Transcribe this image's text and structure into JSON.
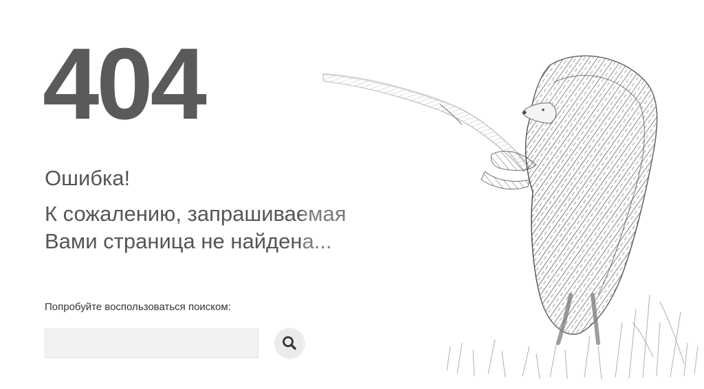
{
  "error": {
    "code": "404",
    "title": "Ошибка!",
    "message_line1": "К сожалению, запрашиваемая",
    "message_line2": "Вами страница не найдена..."
  },
  "search": {
    "hint": "Попробуйте воспользоваться поиском:",
    "value": "",
    "placeholder": "",
    "button_icon": "search-icon"
  },
  "illustration": {
    "subject": "hedgehog-in-the-fog-icon"
  },
  "colors": {
    "code": "#5a5a5a",
    "text": "#555555",
    "input_bg": "#f2f2f2",
    "button_bg": "#ebebeb"
  }
}
